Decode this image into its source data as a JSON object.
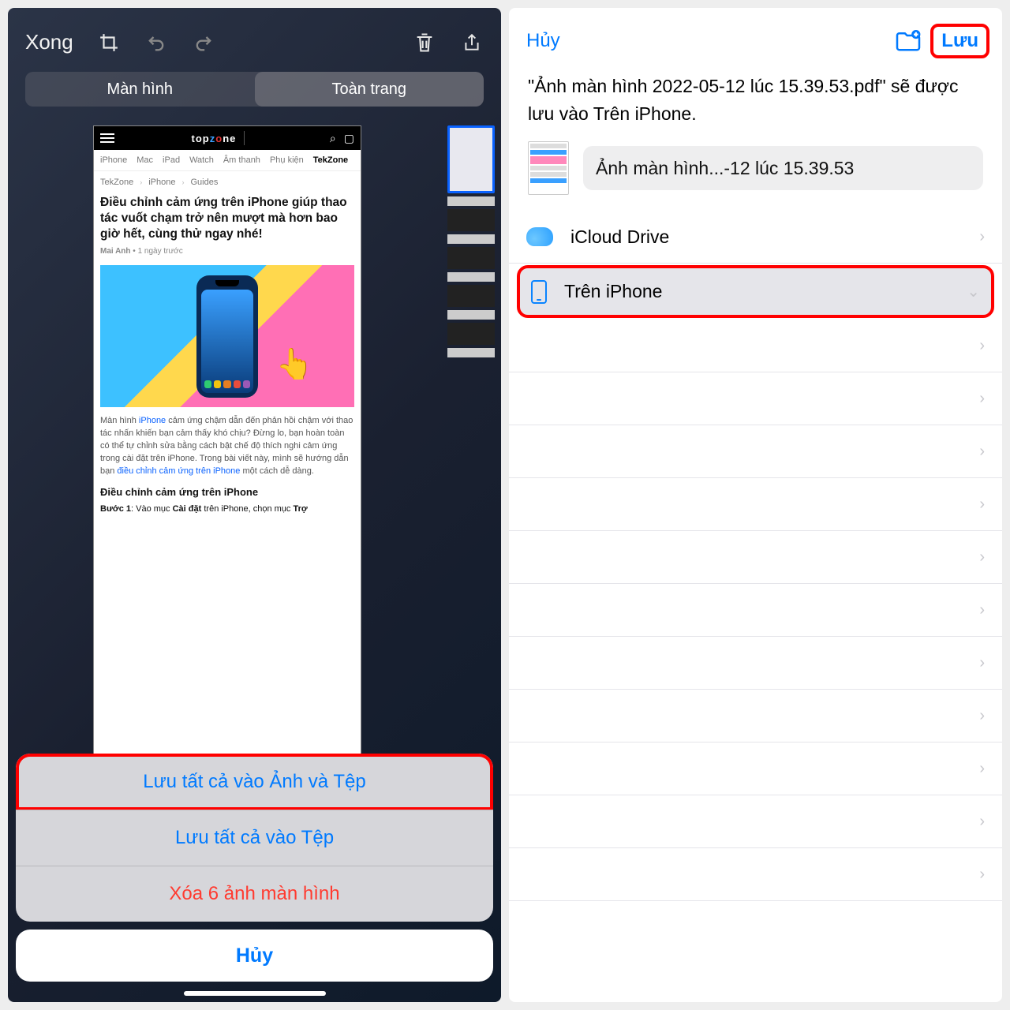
{
  "left": {
    "done": "Xong",
    "segTabs": [
      "Màn hình",
      "Toàn trang"
    ],
    "article": {
      "logo_text": "topzone",
      "apple_badge": "",
      "navcats": [
        "iPhone",
        "Mac",
        "iPad",
        "Watch",
        "Âm thanh",
        "Phụ kiện",
        "TekZone"
      ],
      "crumbs": [
        "TekZone",
        "iPhone",
        "Guides"
      ],
      "title": "Điều chỉnh cảm ứng trên iPhone giúp thao tác vuốt chạm trở nên mượt mà hơn bao giờ hết, cùng thử ngay nhé!",
      "author": "Mai Anh",
      "time": "1 ngày trước",
      "para_a": "Màn hình ",
      "para_link1": "iPhone",
      "para_b": " cảm ứng chậm dẫn đến phản hồi chậm với thao tác nhấn khiến bạn cảm thấy khó chịu? Đừng lo, bạn hoàn toàn có thể tự chỉnh sửa bằng cách bật chế độ thích nghi cảm ứng trong cài đặt trên iPhone. Trong bài viết này, mình sẽ hướng dẫn bạn ",
      "para_link2": "điều chỉnh cảm ứng trên iPhone",
      "para_c": " một cách dễ dàng.",
      "h2": "Điều chỉnh cảm ứng trên iPhone",
      "step1_a": "Bước 1",
      "step1_b": ": Vào mục ",
      "step1_c": "Cài đặt",
      "step1_d": " trên iPhone, chọn mục ",
      "step1_e": "Trợ"
    },
    "sheet": {
      "opt1": "Lưu tất cả vào Ảnh và Tệp",
      "opt2": "Lưu tất cả vào Tệp",
      "opt3": "Xóa 6 ảnh màn hình",
      "cancel": "Hủy"
    }
  },
  "right": {
    "cancel": "Hủy",
    "save": "Lưu",
    "desc": "\"Ảnh màn hình 2022-05-12 lúc 15.39.53.pdf\" sẽ được lưu vào Trên iPhone.",
    "filename": "Ảnh màn hình...-12 lúc 15.39.53",
    "locations": {
      "icloud": "iCloud Drive",
      "oniphone": "Trên iPhone"
    }
  }
}
